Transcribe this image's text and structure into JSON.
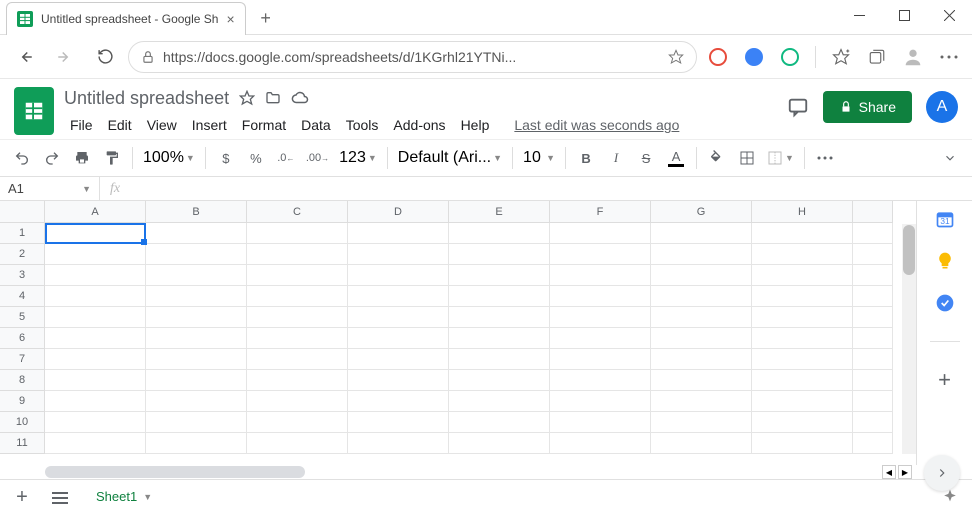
{
  "browser": {
    "tab_title": "Untitled spreadsheet - Google Sh",
    "url": "https://docs.google.com/spreadsheets/d/1KGrhl21YTNi..."
  },
  "doc": {
    "title": "Untitled spreadsheet",
    "menus": [
      "File",
      "Edit",
      "View",
      "Insert",
      "Format",
      "Data",
      "Tools",
      "Add-ons",
      "Help"
    ],
    "last_edit": "Last edit was seconds ago",
    "share_label": "Share",
    "avatar_initial": "A"
  },
  "toolbar": {
    "zoom": "100%",
    "num_format": "123",
    "font": "Default (Ari...",
    "font_size": "10"
  },
  "fx": {
    "name_box": "A1",
    "fx_label": "fx"
  },
  "grid": {
    "cols": [
      "A",
      "B",
      "C",
      "D",
      "E",
      "F",
      "G",
      "H"
    ],
    "rows": [
      "1",
      "2",
      "3",
      "4",
      "5",
      "6",
      "7",
      "8",
      "9",
      "10",
      "11"
    ],
    "selected": "A1"
  },
  "sheets": {
    "active": "Sheet1"
  }
}
